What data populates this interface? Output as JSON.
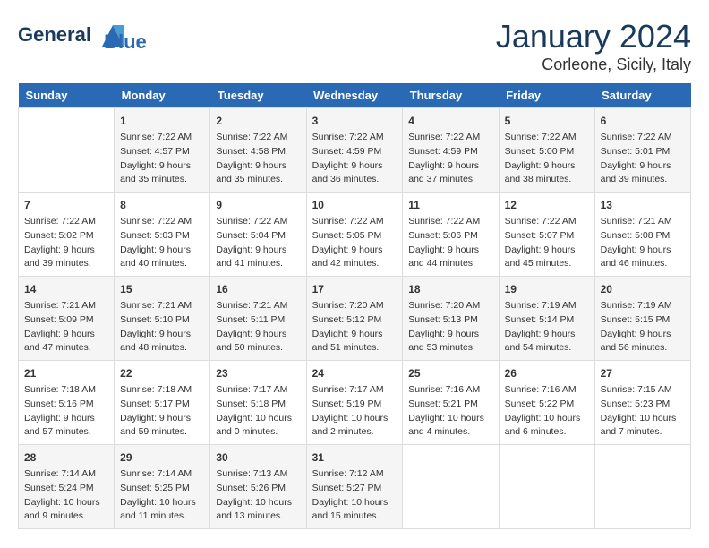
{
  "header": {
    "logo_line1": "General",
    "logo_line2": "Blue",
    "month": "January 2024",
    "location": "Corleone, Sicily, Italy"
  },
  "days_of_week": [
    "Sunday",
    "Monday",
    "Tuesday",
    "Wednesday",
    "Thursday",
    "Friday",
    "Saturday"
  ],
  "weeks": [
    [
      {
        "day": "",
        "content": ""
      },
      {
        "day": "1",
        "content": "Sunrise: 7:22 AM\nSunset: 4:57 PM\nDaylight: 9 hours\nand 35 minutes."
      },
      {
        "day": "2",
        "content": "Sunrise: 7:22 AM\nSunset: 4:58 PM\nDaylight: 9 hours\nand 35 minutes."
      },
      {
        "day": "3",
        "content": "Sunrise: 7:22 AM\nSunset: 4:59 PM\nDaylight: 9 hours\nand 36 minutes."
      },
      {
        "day": "4",
        "content": "Sunrise: 7:22 AM\nSunset: 4:59 PM\nDaylight: 9 hours\nand 37 minutes."
      },
      {
        "day": "5",
        "content": "Sunrise: 7:22 AM\nSunset: 5:00 PM\nDaylight: 9 hours\nand 38 minutes."
      },
      {
        "day": "6",
        "content": "Sunrise: 7:22 AM\nSunset: 5:01 PM\nDaylight: 9 hours\nand 39 minutes."
      }
    ],
    [
      {
        "day": "7",
        "content": "Sunrise: 7:22 AM\nSunset: 5:02 PM\nDaylight: 9 hours\nand 39 minutes."
      },
      {
        "day": "8",
        "content": "Sunrise: 7:22 AM\nSunset: 5:03 PM\nDaylight: 9 hours\nand 40 minutes."
      },
      {
        "day": "9",
        "content": "Sunrise: 7:22 AM\nSunset: 5:04 PM\nDaylight: 9 hours\nand 41 minutes."
      },
      {
        "day": "10",
        "content": "Sunrise: 7:22 AM\nSunset: 5:05 PM\nDaylight: 9 hours\nand 42 minutes."
      },
      {
        "day": "11",
        "content": "Sunrise: 7:22 AM\nSunset: 5:06 PM\nDaylight: 9 hours\nand 44 minutes."
      },
      {
        "day": "12",
        "content": "Sunrise: 7:22 AM\nSunset: 5:07 PM\nDaylight: 9 hours\nand 45 minutes."
      },
      {
        "day": "13",
        "content": "Sunrise: 7:21 AM\nSunset: 5:08 PM\nDaylight: 9 hours\nand 46 minutes."
      }
    ],
    [
      {
        "day": "14",
        "content": "Sunrise: 7:21 AM\nSunset: 5:09 PM\nDaylight: 9 hours\nand 47 minutes."
      },
      {
        "day": "15",
        "content": "Sunrise: 7:21 AM\nSunset: 5:10 PM\nDaylight: 9 hours\nand 48 minutes."
      },
      {
        "day": "16",
        "content": "Sunrise: 7:21 AM\nSunset: 5:11 PM\nDaylight: 9 hours\nand 50 minutes."
      },
      {
        "day": "17",
        "content": "Sunrise: 7:20 AM\nSunset: 5:12 PM\nDaylight: 9 hours\nand 51 minutes."
      },
      {
        "day": "18",
        "content": "Sunrise: 7:20 AM\nSunset: 5:13 PM\nDaylight: 9 hours\nand 53 minutes."
      },
      {
        "day": "19",
        "content": "Sunrise: 7:19 AM\nSunset: 5:14 PM\nDaylight: 9 hours\nand 54 minutes."
      },
      {
        "day": "20",
        "content": "Sunrise: 7:19 AM\nSunset: 5:15 PM\nDaylight: 9 hours\nand 56 minutes."
      }
    ],
    [
      {
        "day": "21",
        "content": "Sunrise: 7:18 AM\nSunset: 5:16 PM\nDaylight: 9 hours\nand 57 minutes."
      },
      {
        "day": "22",
        "content": "Sunrise: 7:18 AM\nSunset: 5:17 PM\nDaylight: 9 hours\nand 59 minutes."
      },
      {
        "day": "23",
        "content": "Sunrise: 7:17 AM\nSunset: 5:18 PM\nDaylight: 10 hours\nand 0 minutes."
      },
      {
        "day": "24",
        "content": "Sunrise: 7:17 AM\nSunset: 5:19 PM\nDaylight: 10 hours\nand 2 minutes."
      },
      {
        "day": "25",
        "content": "Sunrise: 7:16 AM\nSunset: 5:21 PM\nDaylight: 10 hours\nand 4 minutes."
      },
      {
        "day": "26",
        "content": "Sunrise: 7:16 AM\nSunset: 5:22 PM\nDaylight: 10 hours\nand 6 minutes."
      },
      {
        "day": "27",
        "content": "Sunrise: 7:15 AM\nSunset: 5:23 PM\nDaylight: 10 hours\nand 7 minutes."
      }
    ],
    [
      {
        "day": "28",
        "content": "Sunrise: 7:14 AM\nSunset: 5:24 PM\nDaylight: 10 hours\nand 9 minutes."
      },
      {
        "day": "29",
        "content": "Sunrise: 7:14 AM\nSunset: 5:25 PM\nDaylight: 10 hours\nand 11 minutes."
      },
      {
        "day": "30",
        "content": "Sunrise: 7:13 AM\nSunset: 5:26 PM\nDaylight: 10 hours\nand 13 minutes."
      },
      {
        "day": "31",
        "content": "Sunrise: 7:12 AM\nSunset: 5:27 PM\nDaylight: 10 hours\nand 15 minutes."
      },
      {
        "day": "",
        "content": ""
      },
      {
        "day": "",
        "content": ""
      },
      {
        "day": "",
        "content": ""
      }
    ]
  ]
}
